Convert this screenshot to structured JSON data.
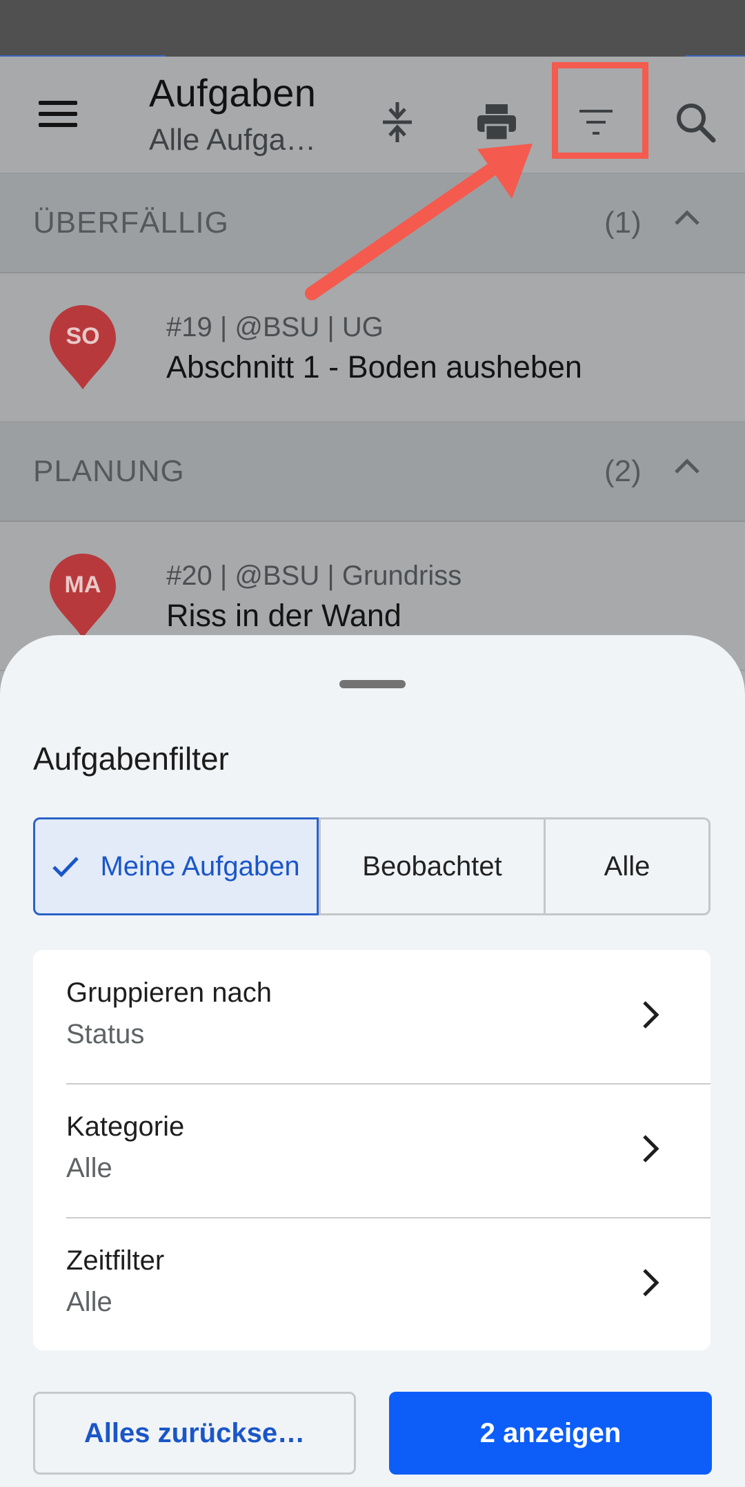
{
  "app_bar": {
    "title": "Aufgaben",
    "subtitle": "Alle Aufga…",
    "icons": [
      "menu-icon",
      "collapse-icon",
      "print-icon",
      "filter-icon",
      "search-icon"
    ]
  },
  "sections": [
    {
      "label": "ÜBERFÄLLIG",
      "count": "(1)"
    },
    {
      "label": "PLANUNG",
      "count": "(2)"
    }
  ],
  "tasks": [
    {
      "avatar": "SO",
      "meta": "#19 | @BSU | UG",
      "name": "Abschnitt 1 - Boden ausheben"
    },
    {
      "avatar": "MA",
      "meta": "#20 | @BSU | Grundriss",
      "name": "Riss in der Wand"
    }
  ],
  "sheet": {
    "title": "Aufgabenfilter",
    "segments": [
      "Meine Aufgaben",
      "Beobachtet",
      "Alle"
    ],
    "selected_segment": "Meine Aufgaben",
    "options": [
      {
        "label": "Gruppieren nach",
        "value": "Status"
      },
      {
        "label": "Kategorie",
        "value": "Alle"
      },
      {
        "label": "Zeitfilter",
        "value": "Alle"
      }
    ],
    "reset_label": "Alles zurückse…",
    "show_label": "2 anzeigen"
  },
  "colors": {
    "accent": "#0d5ef8",
    "pin": "#c8383b",
    "annotation": "#f45a4d"
  }
}
